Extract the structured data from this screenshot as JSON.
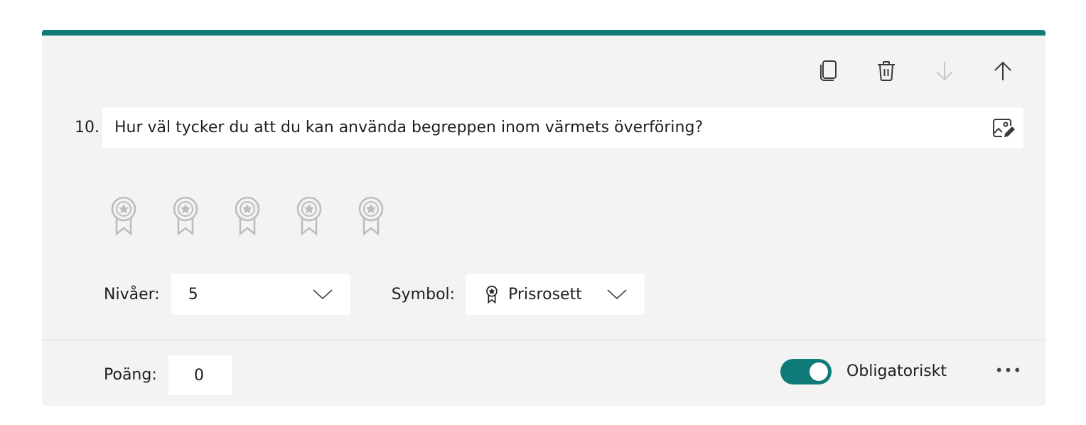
{
  "colors": {
    "accent": "#0f7b78",
    "card_bg": "#f3f3f3",
    "icon_muted": "#bdbdbd",
    "icon_disabled": "#c6c6c6",
    "icon_dark": "#3a3a3a"
  },
  "toolbar": {
    "copy_icon": "copy-icon",
    "delete_icon": "trash-icon",
    "move_down_icon": "arrow-down-icon",
    "move_up_icon": "arrow-up-icon"
  },
  "question": {
    "number": "10.",
    "text": "Hur väl tycker du att du kan använda begreppen inom värmets överföring?",
    "image_icon": "insert-image-icon"
  },
  "rating": {
    "levels_count": 5,
    "symbol_icon": "rosette-icon"
  },
  "settings": {
    "levels_label": "Nivåer:",
    "levels_value": "5",
    "symbol_label": "Symbol:",
    "symbol_value": "Prisrosett"
  },
  "footer": {
    "points_label": "Poäng:",
    "points_value": "0",
    "required_label": "Obligatoriskt",
    "required_on": true,
    "more_label": "•••"
  }
}
